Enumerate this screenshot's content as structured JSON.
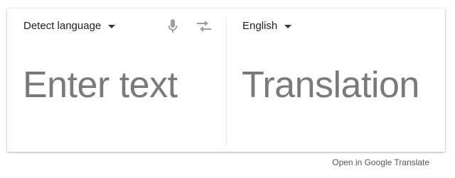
{
  "source": {
    "language_label": "Detect language",
    "placeholder": "Enter text",
    "mic_icon": "microphone-icon",
    "swap_icon": "swap-languages-icon"
  },
  "target": {
    "language_label": "English",
    "placeholder": "Translation"
  },
  "footer": {
    "link_text": "Open in Google Translate"
  },
  "colors": {
    "icon": "#9e9e9e",
    "placeholder": "#7a7a7a",
    "text": "#222222"
  }
}
